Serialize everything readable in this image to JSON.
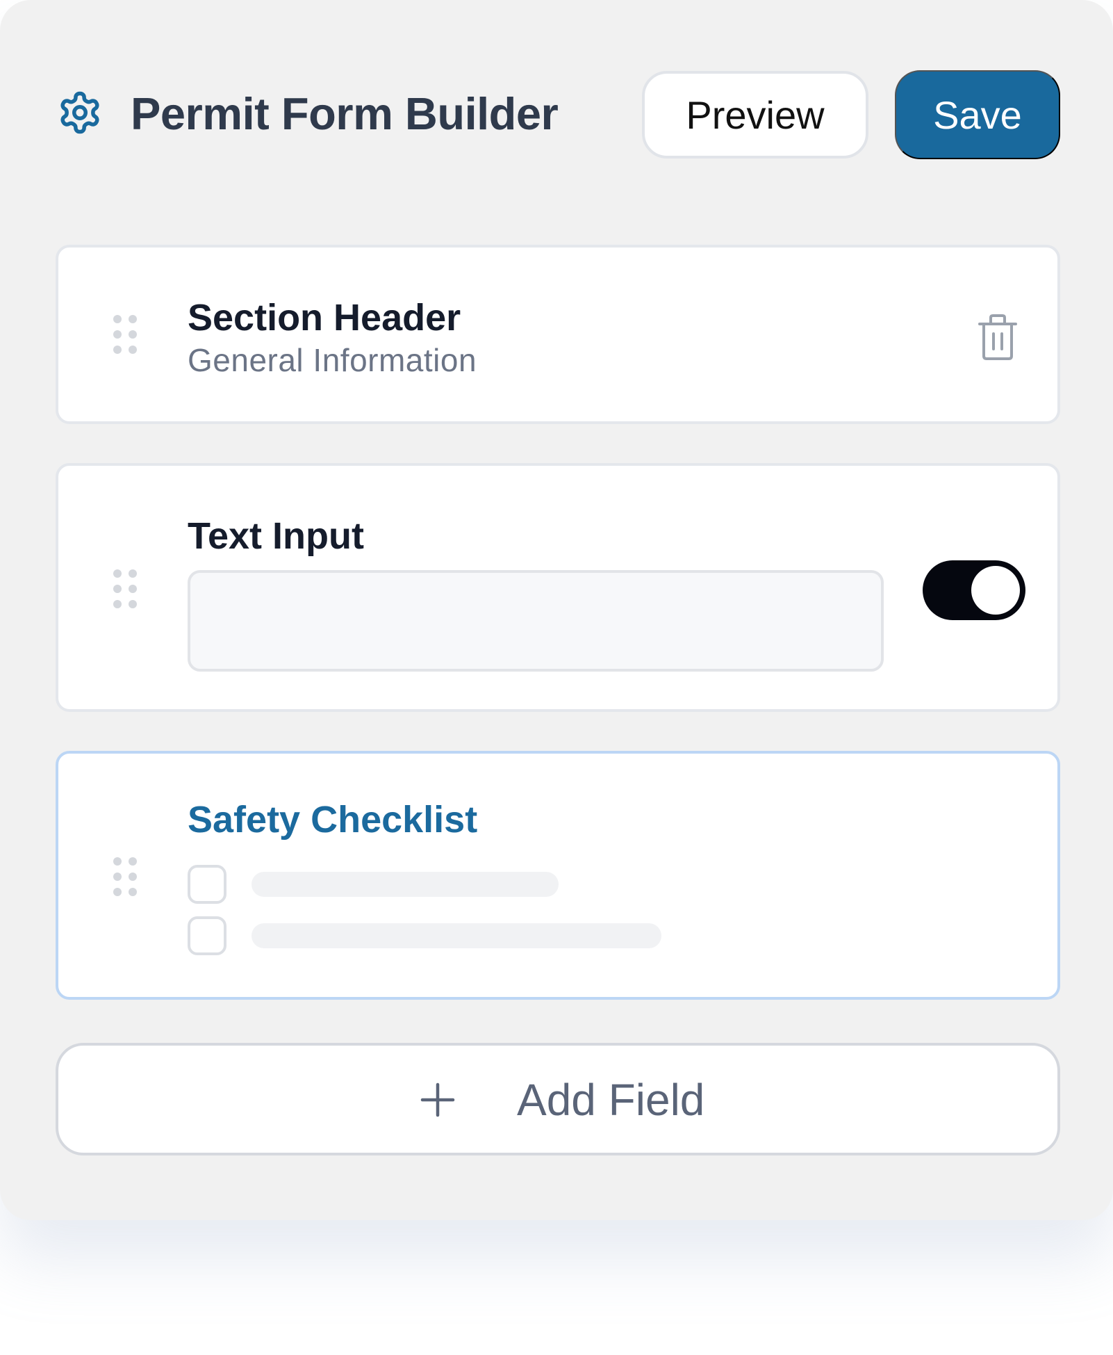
{
  "header": {
    "icon": "gear-icon",
    "title": "Permit Form Builder",
    "preview_label": "Preview",
    "save_label": "Save"
  },
  "fields": [
    {
      "label": "Section Header",
      "subtitle": "General Information",
      "action_icon": "trash-icon"
    },
    {
      "label": "Text Input",
      "input_value": "",
      "toggle_on": true
    },
    {
      "label": "Safety Checklist",
      "selected": true,
      "checkbox_items": 2
    }
  ],
  "add_field_label": "Add Field",
  "colors": {
    "accent": "#19699d",
    "title": "#2f3a4c",
    "panel_bg": "#f1f1f1",
    "selected_border": "#bcd6f5",
    "toggle_on": "#05070f"
  }
}
